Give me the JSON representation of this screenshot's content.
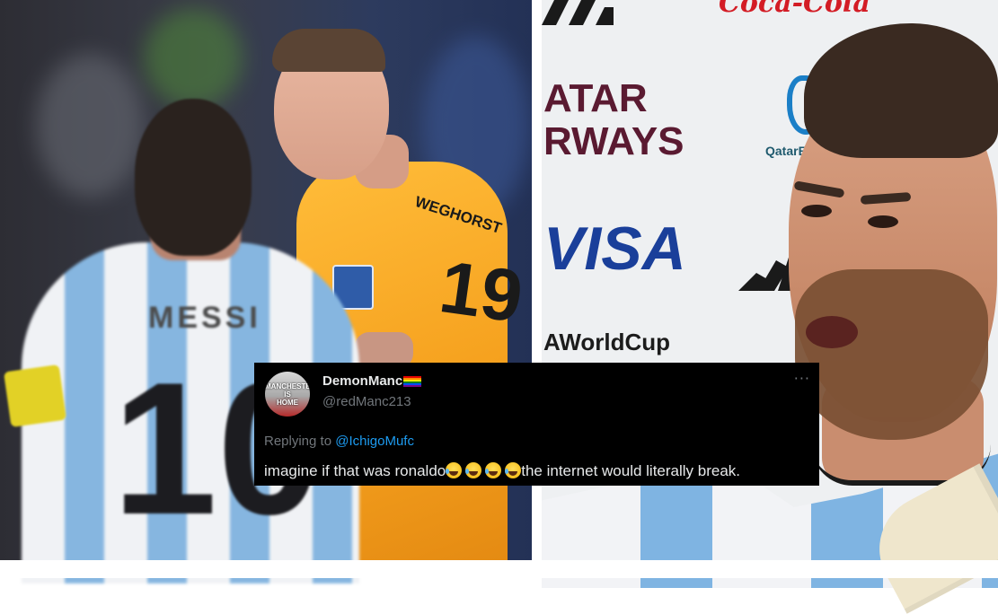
{
  "left_photo": {
    "back_player_jersey_name": "MESSI",
    "back_player_jersey_number": "10",
    "front_player_jersey_name": "WEGHORST",
    "front_player_jersey_number": "19"
  },
  "right_photo": {
    "sponsor_qatar_line1": "ATAR",
    "sponsor_qatar_line2": "RWAYS",
    "sponsor_visa": "VISA",
    "sponsor_worldcup": "AWorldCup",
    "sponsor_energy": "QatarE",
    "sponsor_script": "Coca-Cola"
  },
  "tweet": {
    "avatar_text_line1": "MANCHESTER IS",
    "avatar_text_line2": "HOME",
    "display_name": "DemonManc",
    "handle": "@redManc213",
    "more_label": "···",
    "replying_prefix": "Replying to",
    "replying_to": "@IchigoMufc",
    "body_before_emoji": "imagine if that was ronaldo",
    "body_after_emoji": "the internet would literally break.",
    "emoji_count": 4
  },
  "colors": {
    "tweet_background": "#000000",
    "tweet_text": "#e7e9ea",
    "tweet_muted": "#71767b",
    "tweet_link": "#1d9bf0",
    "divider": "#ffffff"
  }
}
